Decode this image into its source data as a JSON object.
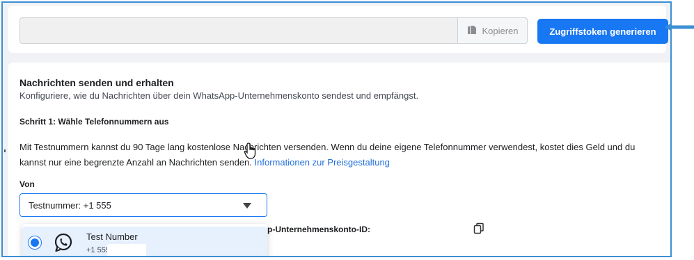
{
  "token_section": {
    "token_value": "",
    "copy_label": "Kopieren",
    "generate_label": "Zugriffstoken generieren"
  },
  "messages": {
    "title": "Nachrichten senden und erhalten",
    "subtitle": "Konfiguriere, wie du Nachrichten über dein WhatsApp-Unternehmenskonto sendest und empfängst.",
    "step1": "Schritt 1: Wähle Telefonnummern aus",
    "description": "Mit Testnummern kannst du 90 Tage lang kostenlose Nachrichten versenden. Wenn du deine eigene Telefonnummer verwendest, kostet dies Geld und du kannst nur eine begrenzte Anzahl an Nachrichten senden.",
    "pricing_link": "Informationen zur Preisgestaltung",
    "from_label": "Von",
    "from_value": "Testnummer: +1 555",
    "waba_label": "p-Unternehmenskonto-ID:",
    "dropdown_option": {
      "name": "Test Number",
      "number": "+1 555",
      "selected": true
    }
  },
  "colors": {
    "accent": "#1877f2",
    "frame_border": "#3b8fd4",
    "link": "#216fdb"
  }
}
